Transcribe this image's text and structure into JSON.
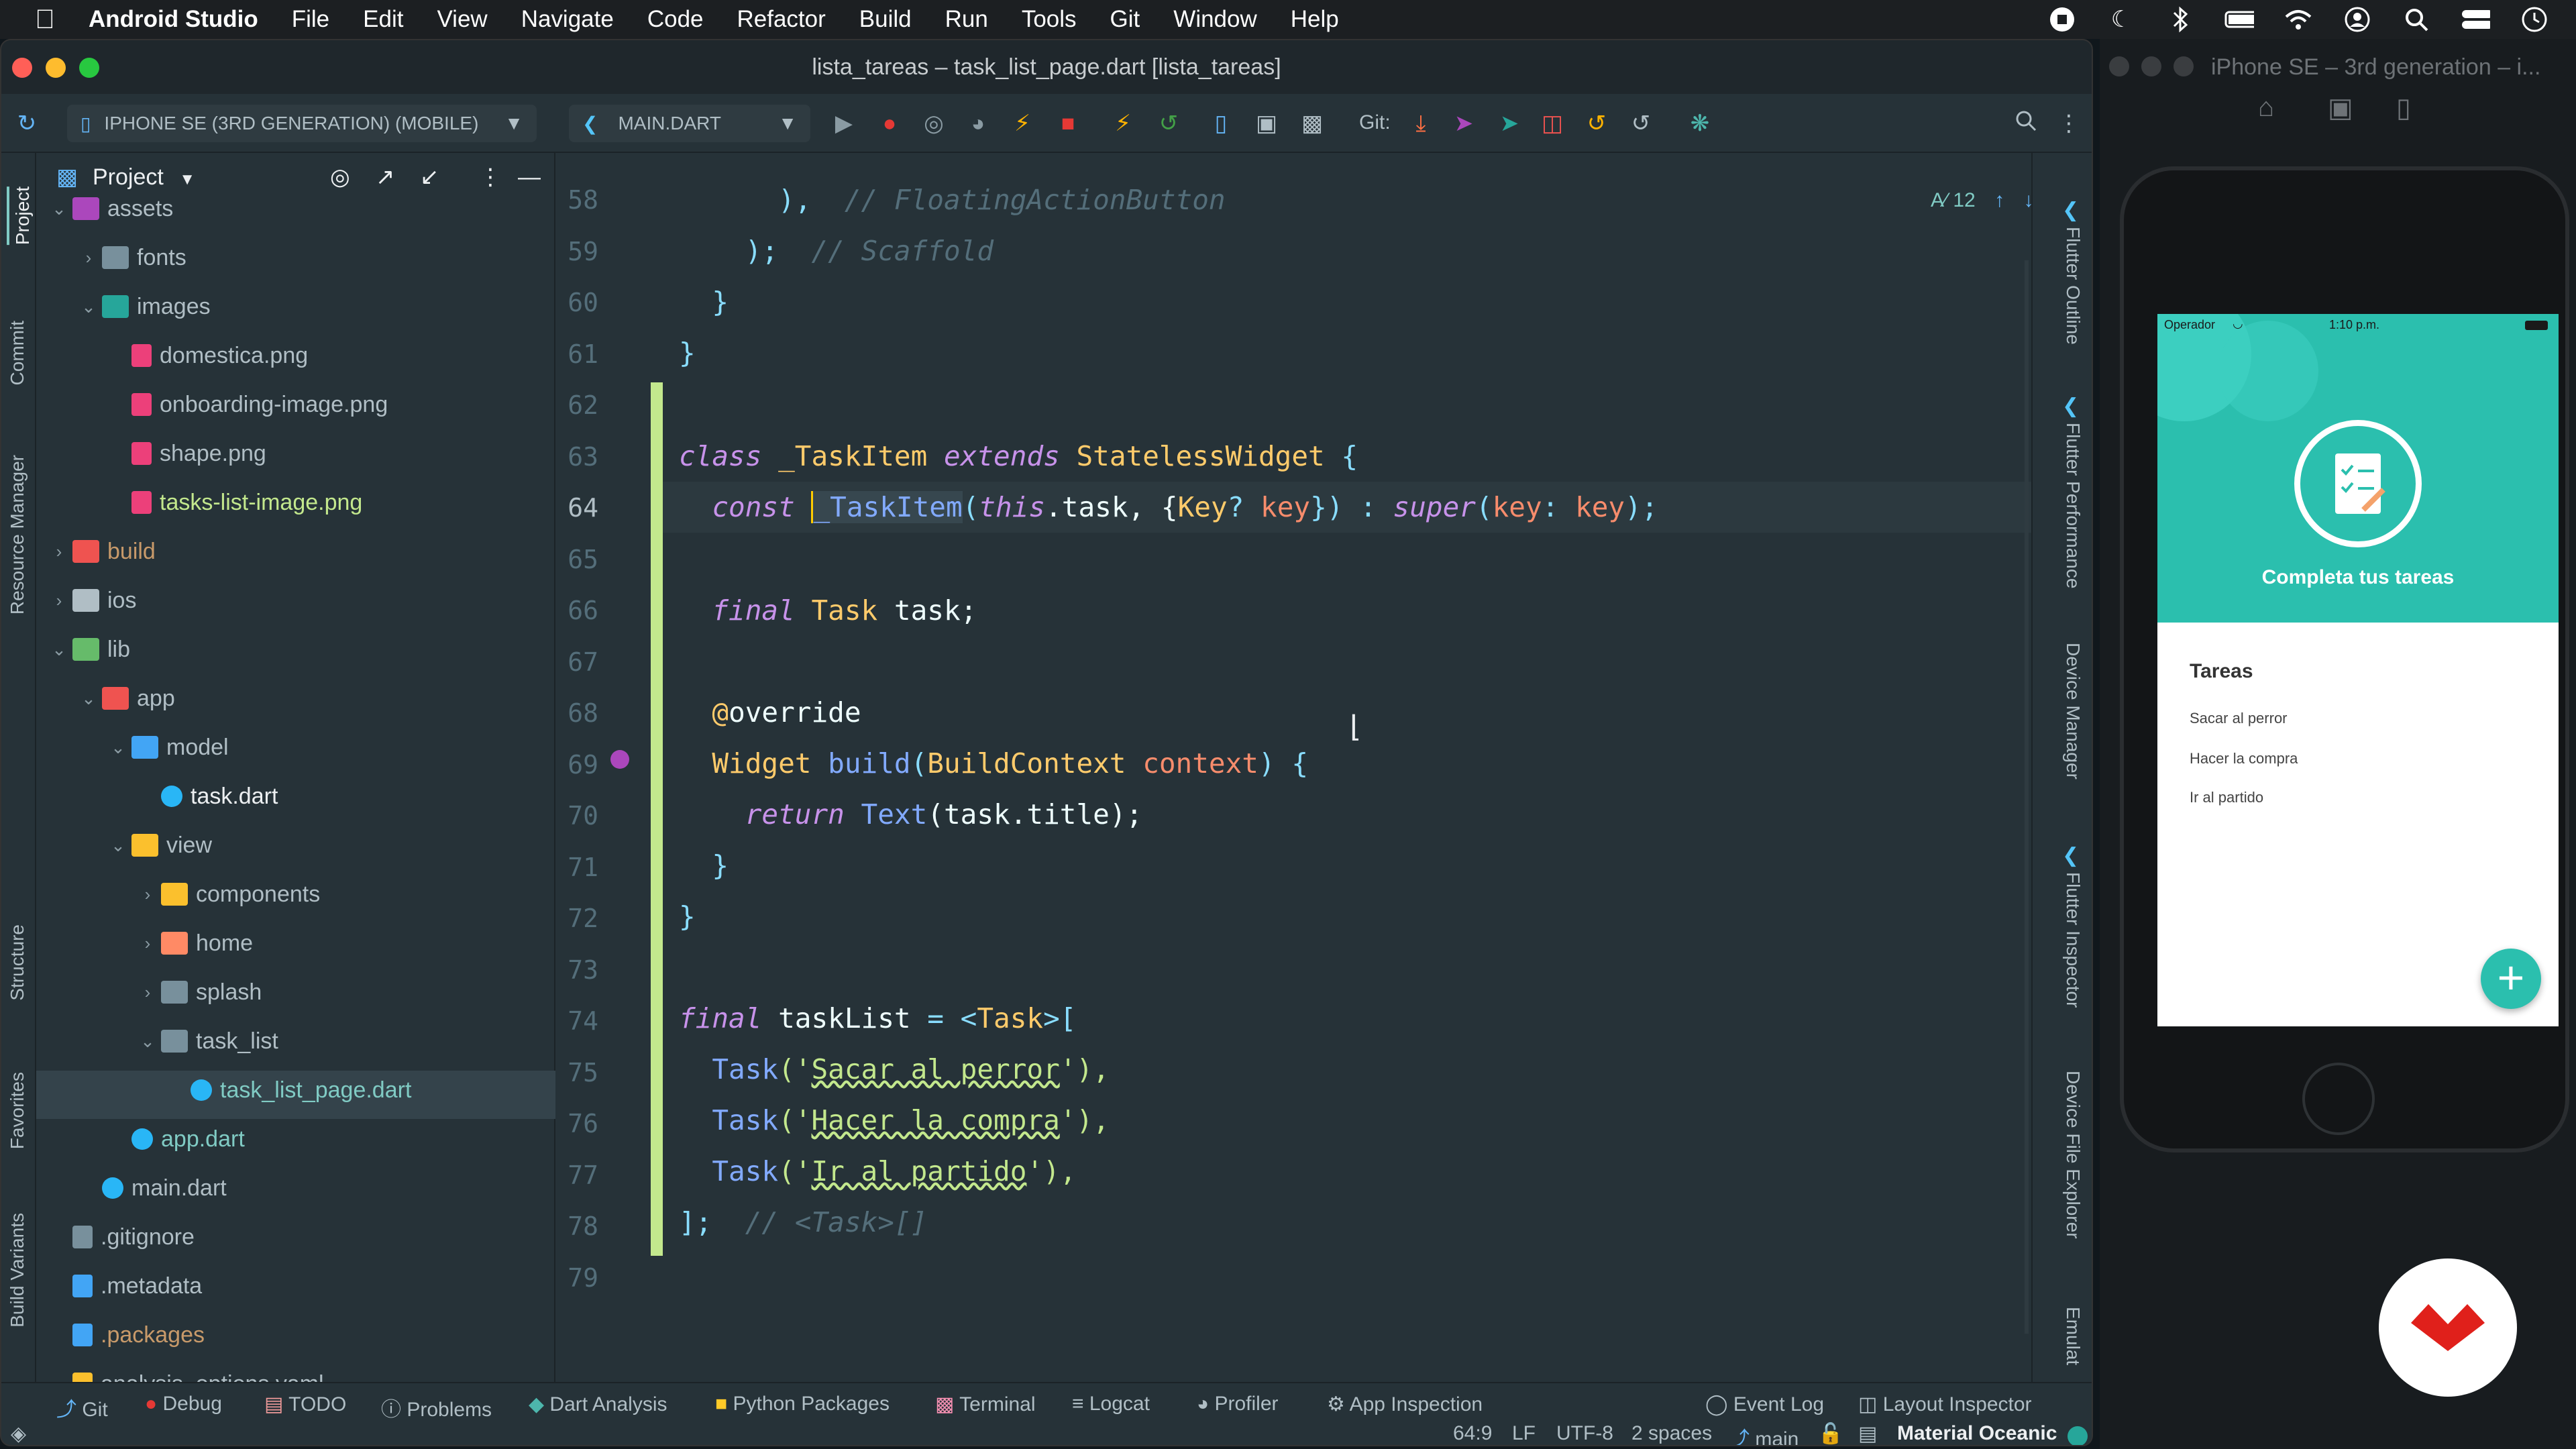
{
  "menubar": {
    "app": "Android Studio",
    "items": [
      "File",
      "Edit",
      "View",
      "Navigate",
      "Code",
      "Refactor",
      "Build",
      "Run",
      "Tools",
      "Git",
      "Window",
      "Help"
    ]
  },
  "window": {
    "title": "lista_tareas – task_list_page.dart [lista_tareas]"
  },
  "toolbar": {
    "device": "IPHONE SE (3RD GENERATION) (MOBILE)",
    "config": "MAIN.DART",
    "git_label": "Git:"
  },
  "left_tabs": [
    "Project",
    "Commit",
    "Resource Manager",
    "Structure",
    "Favorites",
    "Build Variants"
  ],
  "project": {
    "title": "Project",
    "tree": [
      {
        "label": "assets",
        "depth": 1,
        "kind": "folder-purple",
        "open": true,
        "color": "#b0bec5"
      },
      {
        "label": "fonts",
        "depth": 2,
        "kind": "folder-font",
        "open": false,
        "color": "#b0bec5"
      },
      {
        "label": "images",
        "depth": 2,
        "kind": "folder-img",
        "open": true,
        "color": "#b0bec5"
      },
      {
        "label": "domestica.png",
        "depth": 3,
        "kind": "image",
        "color": "#b0bec5"
      },
      {
        "label": "onboarding-image.png",
        "depth": 3,
        "kind": "image",
        "color": "#b0bec5"
      },
      {
        "label": "shape.png",
        "depth": 3,
        "kind": "image",
        "color": "#b0bec5"
      },
      {
        "label": "tasks-list-image.png",
        "depth": 3,
        "kind": "image",
        "color": "#c3e88d"
      },
      {
        "label": "build",
        "depth": 1,
        "kind": "folder-red",
        "open": false,
        "color": "#c89a6a"
      },
      {
        "label": "ios",
        "depth": 1,
        "kind": "folder-tool",
        "open": false,
        "color": "#b0bec5"
      },
      {
        "label": "lib",
        "depth": 1,
        "kind": "folder-green",
        "open": true,
        "color": "#b0bec5"
      },
      {
        "label": "app",
        "depth": 2,
        "kind": "folder-red",
        "open": true,
        "color": "#b0bec5"
      },
      {
        "label": "model",
        "depth": 3,
        "kind": "folder-blue",
        "open": true,
        "color": "#b0bec5"
      },
      {
        "label": "task.dart",
        "depth": 4,
        "kind": "dart",
        "color": "#eceff1"
      },
      {
        "label": "view",
        "depth": 3,
        "kind": "folder-yellow",
        "open": true,
        "color": "#b0bec5"
      },
      {
        "label": "components",
        "depth": 4,
        "kind": "folder-yellow",
        "open": false,
        "color": "#b0bec5"
      },
      {
        "label": "home",
        "depth": 4,
        "kind": "folder-home",
        "open": false,
        "color": "#b0bec5"
      },
      {
        "label": "splash",
        "depth": 4,
        "kind": "folder-plain",
        "open": false,
        "color": "#b0bec5"
      },
      {
        "label": "task_list",
        "depth": 4,
        "kind": "folder-plain",
        "open": true,
        "color": "#b0bec5"
      },
      {
        "label": "task_list_page.dart",
        "depth": 5,
        "kind": "dart",
        "color": "#80cbc4"
      },
      {
        "label": "app.dart",
        "depth": 3,
        "kind": "dart",
        "color": "#80cbc4"
      },
      {
        "label": "main.dart",
        "depth": 2,
        "kind": "dart",
        "color": "#b0bec5"
      },
      {
        "label": ".gitignore",
        "depth": 1,
        "kind": "git",
        "color": "#b0bec5"
      },
      {
        "label": ".metadata",
        "depth": 1,
        "kind": "flutter",
        "color": "#b0bec5"
      },
      {
        "label": ".packages",
        "depth": 1,
        "kind": "flutter",
        "color": "#c89a6a"
      },
      {
        "label": "analysis_options.yaml",
        "depth": 1,
        "kind": "yaml",
        "color": "#b0bec5"
      }
    ]
  },
  "editor": {
    "line_numbers": [
      "58",
      "59",
      "60",
      "61",
      "62",
      "63",
      "64",
      "65",
      "66",
      "67",
      "68",
      "69",
      "70",
      "71",
      "72",
      "73",
      "74",
      "75",
      "76",
      "77",
      "78",
      "79"
    ],
    "inspection_count": "12",
    "lines": {
      "l58": "),",
      "l58c": "// FloatingActionButton",
      "l59": ");",
      "l59c": "// Scaffold",
      "l60": "}",
      "l61": "}",
      "l63_kw": "class",
      "l63_name": "_TaskItem",
      "l63_ext": "extends",
      "l63_base": "StatelessWidget",
      "l63_br": "{",
      "l64_kw": "const",
      "l64_name": "_TaskItem",
      "l64_rest1": "(",
      "l64_this": "this",
      "l64_task": ".task, {",
      "l64_key": "Key",
      "l64_q": "?",
      "l64_keyp": "key",
      "l64_close": "}) :",
      "l64_super": "super",
      "l64_open": "(",
      "l64_keyn": "key",
      "l64_col": ":",
      "l64_keyv": "key",
      "l64_end": ");",
      "l66_kw": "final",
      "l66_ty": "Task",
      "l66_rest": "task;",
      "l68_at": "@",
      "l68_ov": "override",
      "l69_ty": "Widget",
      "l69_fn": "build",
      "l69_p": "(",
      "l69_bc": "BuildContext",
      "l69_ctx": "context",
      "l69_end": ") {",
      "l70_kw": "return",
      "l70_fn": "Text",
      "l70_rest": "(task.title);",
      "l71": "}",
      "l72": "}",
      "l74_kw": "final",
      "l74_name": "taskList",
      "l74_eq": "=",
      "l74_lt": "<",
      "l74_ty": "Task",
      "l74_gt": ">[",
      "task_fn": "Task",
      "l75_q1": "('",
      "l75_s": "Sacar al perror",
      "l75_q2": "'),",
      "l76_s": "Hacer la compra",
      "l77_s": "Ir al partido",
      "l78": "];",
      "l78c": "// <Task>[]"
    }
  },
  "right_tabs": [
    "Flutter Outline",
    "Flutter Performance",
    "Device Manager",
    "Flutter Inspector",
    "Device File Explorer",
    "Emulat"
  ],
  "bottom_tabs": [
    "Git",
    "Debug",
    "TODO",
    "Problems",
    "Dart Analysis",
    "Python Packages",
    "Terminal",
    "Logcat",
    "Profiler",
    "App Inspection"
  ],
  "bottom_right_tabs": [
    "Event Log",
    "Layout Inspector"
  ],
  "status": {
    "position": "64:9",
    "line_sep": "LF",
    "encoding": "UTF-8",
    "indent": "2 spaces",
    "branch": "main",
    "theme": "Material Oceanic"
  },
  "simulator": {
    "title": "iPhone SE – 3rd generation – i...",
    "carrier": "Operador",
    "time": "1:10 p.m.",
    "header_title": "Completa tus tareas",
    "list_title": "Tareas",
    "tasks": [
      "Sacar al perror",
      "Hacer la compra",
      "Ir al partido"
    ],
    "accent": "#2bbfae"
  }
}
